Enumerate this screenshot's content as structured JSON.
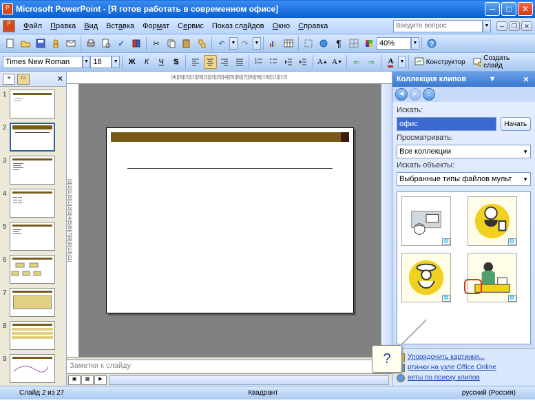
{
  "window": {
    "app_name": "Microsoft PowerPoint",
    "doc_title": "[Я готов работать в современном офисе]"
  },
  "menu": {
    "file": "Файл",
    "edit": "Правка",
    "view": "Вид",
    "insert": "Вставка",
    "format": "Формат",
    "tools": "Сервис",
    "slideshow": "Показ слайдов",
    "window": "Окно",
    "help": "Справка"
  },
  "ask_box": {
    "placeholder": "Введите вопрос"
  },
  "format_toolbar": {
    "font": "Times New Roman",
    "size": "18",
    "bold": "Ж",
    "italic": "К",
    "underline": "Ч",
    "shadow": "S",
    "designer": "Конструктор",
    "new_slide": "Создать слайд"
  },
  "standard_toolbar": {
    "zoom": "40%"
  },
  "ruler_h": "|4|||3|||2|||1|||0|||1|||2|||3|||4|||5|||6|||7|||8|||9|||10|||11|||12|",
  "ruler_v": "|3||2||1||0||1||2||3||4||5||6||7||8||9||10||11|",
  "slides": {
    "count": 9,
    "selected": 2,
    "numbers": [
      "1",
      "2",
      "3",
      "4",
      "5",
      "6",
      "7",
      "8",
      "9"
    ]
  },
  "notes": {
    "placeholder": "Заметки к слайду"
  },
  "taskpane": {
    "title": "Коллекция клипов",
    "search_label": "Искать:",
    "search_value": "офис",
    "go": "Начать",
    "browse_label": "Просматривать:",
    "browse_value": "Все коллекции",
    "types_label": "Искать объекты:",
    "types_value": "Выбранные типы файлов мульт",
    "links": {
      "organize": "Упорядочить картинки...",
      "online": "ртинки на узле Office Online",
      "tips": "веты по поиску клипов"
    },
    "callout": "?"
  },
  "status": {
    "slide": "Слайд 2 из 27",
    "layout": "Квадрант",
    "lang": "русский (Россия)"
  }
}
